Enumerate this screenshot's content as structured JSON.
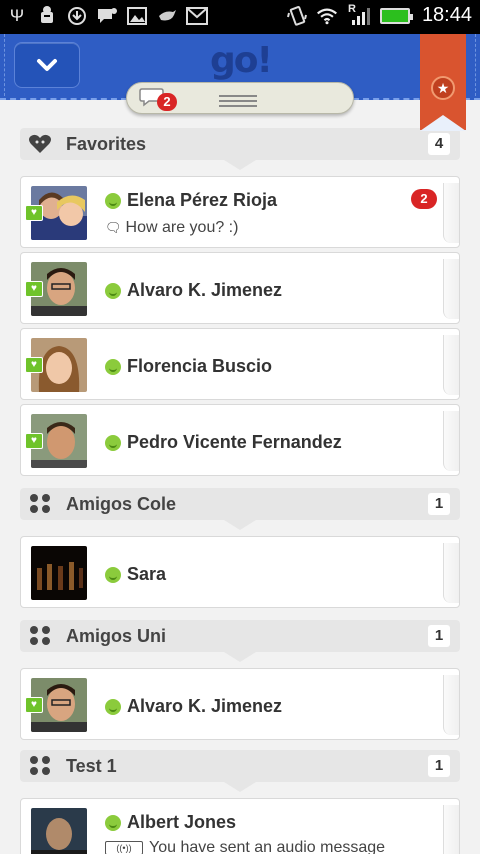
{
  "status_bar": {
    "time": "18:44",
    "signal_label": "R"
  },
  "header": {
    "logo": "go!"
  },
  "tab_bar": {
    "chat_badge": "2"
  },
  "groups": [
    {
      "name": "Favorites",
      "count": "4",
      "contacts": [
        {
          "name": "Elena Pérez Rioja",
          "message": "How are you? :)",
          "badge": "2"
        },
        {
          "name": "Alvaro K. Jimenez"
        },
        {
          "name": "Florencia Buscio"
        },
        {
          "name": "Pedro Vicente Fernandez"
        }
      ]
    },
    {
      "name": "Amigos Cole",
      "count": "1",
      "contacts": [
        {
          "name": "Sara"
        }
      ]
    },
    {
      "name": "Amigos Uni",
      "count": "1",
      "contacts": [
        {
          "name": "Alvaro K. Jimenez"
        }
      ]
    },
    {
      "name": "Test 1",
      "count": "1",
      "contacts": [
        {
          "name": "Albert Jones",
          "message": "You have sent an audio message"
        }
      ]
    }
  ],
  "colors": {
    "header_blue": "#2f5dc4",
    "ribbon": "#d9542f",
    "online_green": "#8bcb3c",
    "badge_red": "#d92525"
  }
}
